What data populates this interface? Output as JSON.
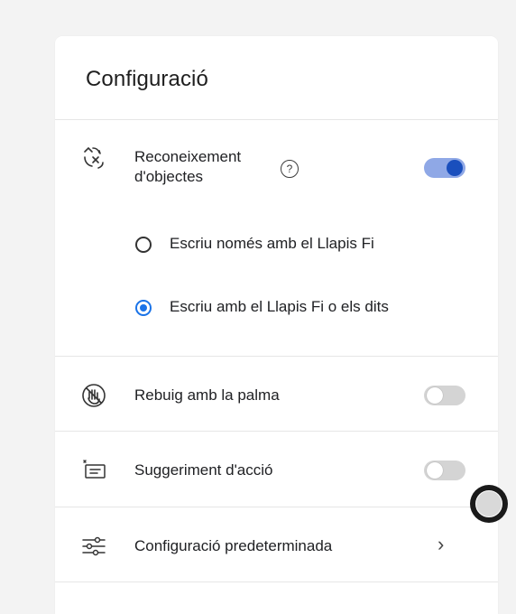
{
  "panel": {
    "title": "Configuració"
  },
  "object_recognition": {
    "label": "Reconeixement d'objectes",
    "help_glyph": "?",
    "icon": "shapes-transform-icon",
    "enabled": true,
    "options": [
      {
        "label": "Escriu només amb el Llapis Fi",
        "selected": false
      },
      {
        "label": "Escriu amb el Llapis Fi o els dits",
        "selected": true
      }
    ]
  },
  "palm_rejection": {
    "label": "Rebuig amb la palma",
    "icon": "palm-hand-icon",
    "enabled": false
  },
  "action_suggestion": {
    "label": "Suggeriment d'acció",
    "icon": "suggestion-card-icon",
    "enabled": false
  },
  "default_settings": {
    "label": "Configuració predeterminada",
    "icon": "sliders-icon",
    "chevron": "›"
  },
  "colors": {
    "accent": "#1a73e8",
    "toggle_on_track": "#8fa8e6",
    "toggle_on_knob": "#1a4fbd",
    "toggle_off_track": "#d4d4d4"
  }
}
